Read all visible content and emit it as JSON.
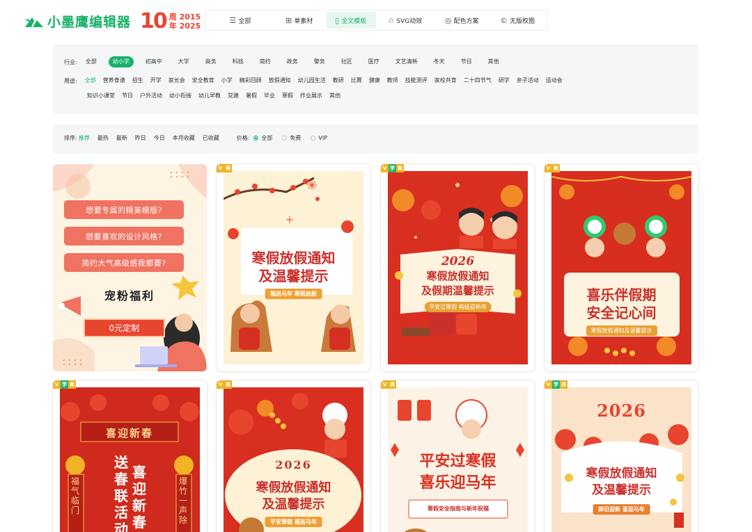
{
  "brand": {
    "name": "小墨鹰编辑器",
    "anniv_num": "10",
    "anniv_line1": "周 2015",
    "anniv_line2": "年 2025"
  },
  "topnav": [
    {
      "label": "全部",
      "icon": "list-icon",
      "glyph": "☰",
      "active": false
    },
    {
      "label": "单素材",
      "icon": "grid-icon",
      "glyph": "⊞",
      "active": false
    },
    {
      "label": "全文模板",
      "icon": "template-icon",
      "glyph": "▯",
      "active": true
    },
    {
      "label": "SVG动效",
      "icon": "star-icon",
      "glyph": "☆",
      "active": false
    },
    {
      "label": "配色方案",
      "icon": "palette-icon",
      "glyph": "◎",
      "active": false
    },
    {
      "label": "无版权图",
      "icon": "copyright-icon",
      "glyph": "©",
      "active": false
    }
  ],
  "filters": {
    "industry_label": "行业:",
    "industry": [
      "全部",
      "幼小学",
      "初高中",
      "大学",
      "商务",
      "科技",
      "简约",
      "政务",
      "警务",
      "社区",
      "医疗",
      "文艺清新",
      "冬天",
      "节日",
      "其他"
    ],
    "industry_active": 1,
    "usage_label": "用途:",
    "usage_row1": [
      "全部",
      "营养食谱",
      "招生",
      "开学",
      "家长会",
      "安全教育",
      "小学",
      "精彩回顾",
      "放假通知",
      "幼儿园生活",
      "教研",
      "比赛",
      "健康",
      "教师",
      "技能测评",
      "家校共育",
      "二十四节气",
      "研学",
      "亲子活动",
      "运动会"
    ],
    "usage_row2": [
      "知识小课堂",
      "节日",
      "户外活动",
      "幼小衔接",
      "幼儿早教",
      "党建",
      "暑假",
      "毕业",
      "寒假",
      "作业展示",
      "其他"
    ]
  },
  "sort": {
    "label": "排序:",
    "options": [
      "推荐",
      "最热",
      "最新",
      "昨日",
      "今日",
      "本月收藏",
      "已收藏"
    ],
    "active": 0,
    "price_label": "价格:",
    "price_options": [
      "全部",
      "免费",
      "VIP"
    ],
    "price_active": 0
  },
  "promo": {
    "q1": "想要专属的精美模版?",
    "q2": "想要喜欢的设计风格?",
    "q3": "简约大气高级感我都要?",
    "welfare": "宠粉福利",
    "cta": "0元定制"
  },
  "badges": {
    "v": "V",
    "x": "学",
    "s": "商"
  },
  "cards": [
    {
      "title1": "寒假放假通知",
      "title2": "及温馨提示",
      "tag": "福启马年 寒假启航",
      "badges": [
        "v",
        "s"
      ]
    },
    {
      "year": "2026",
      "title1": "寒假放假通知",
      "title2": "及假期温馨提示",
      "tag": "平安过寒假 萌娃迎新年",
      "badges": [
        "v",
        "x",
        "s"
      ]
    },
    {
      "title1": "喜乐伴假期",
      "title2": "安全记心间",
      "tag": "寒假放假通知及温馨提示",
      "badges": [
        "v",
        "s"
      ]
    },
    {
      "head": "喜迎新春",
      "c1": "送春联活动",
      "c2": "喜迎新春",
      "s1": "福气临门",
      "s2": "爆竹一声除",
      "badges": [
        "v",
        "x",
        "s"
      ]
    },
    {
      "year": "2026",
      "title1": "寒假放假通知",
      "title2": "及温馨提示",
      "tag": "平安寒假 福运马年",
      "badges": [
        "v",
        "s"
      ]
    },
    {
      "title1": "平安过寒假",
      "title2": "喜乐迎马年",
      "tag": "寒假安全指南与新年祝福",
      "badges": [
        "v",
        "s"
      ]
    },
    {
      "year": "2026",
      "title1": "寒假放假通知",
      "title2": "及温馨提示",
      "tag": "辞旧迎新 喜迎马年",
      "badges": [
        "v",
        "x",
        "s"
      ]
    }
  ]
}
